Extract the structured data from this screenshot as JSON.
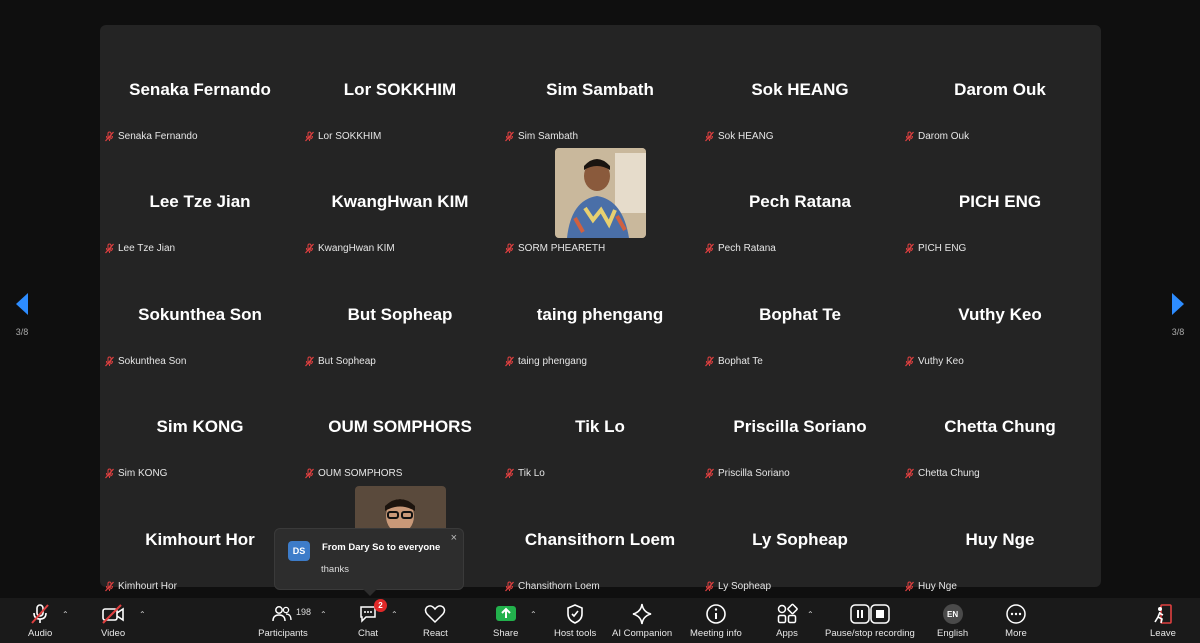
{
  "participants": [
    {
      "name": "Senaka Fernando",
      "label": "Senaka Fernando"
    },
    {
      "name": "Lor SOKKHIM",
      "label": "Lor SOKKHIM"
    },
    {
      "name": "Sim Sambath",
      "label": "Sim Sambath"
    },
    {
      "name": "Sok HEANG",
      "label": "Sok HEANG"
    },
    {
      "name": "Darom Ouk",
      "label": "Darom Ouk"
    },
    {
      "name": "Lee Tze Jian",
      "label": "Lee Tze Jian"
    },
    {
      "name": "KwangHwan KIM",
      "label": "KwangHwan KIM"
    },
    {
      "name": "",
      "label": "SORM PHEARETH"
    },
    {
      "name": "Pech Ratana",
      "label": "Pech Ratana"
    },
    {
      "name": "PICH ENG",
      "label": "PICH ENG"
    },
    {
      "name": "Sokunthea Son",
      "label": "Sokunthea Son"
    },
    {
      "name": "But Sopheap",
      "label": "But Sopheap"
    },
    {
      "name": "taing phengang",
      "label": "taing phengang"
    },
    {
      "name": "Bophat Te",
      "label": "Bophat Te"
    },
    {
      "name": "Vuthy Keo",
      "label": "Vuthy Keo"
    },
    {
      "name": "Sim KONG",
      "label": "Sim KONG"
    },
    {
      "name": "OUM SOMPHORS",
      "label": "OUM SOMPHORS"
    },
    {
      "name": "Tik Lo",
      "label": "Tik Lo"
    },
    {
      "name": "Priscilla Soriano",
      "label": "Priscilla Soriano"
    },
    {
      "name": "Chetta Chung",
      "label": "Chetta Chung"
    },
    {
      "name": "Kimhourt Hor",
      "label": "Kimhourt Hor"
    },
    {
      "name": "",
      "label": ""
    },
    {
      "name": "Chansithorn Loem",
      "label": "Chansithorn Loem"
    },
    {
      "name": "Ly Sopheap",
      "label": "Ly Sopheap"
    },
    {
      "name": "Huy Nge",
      "label": "Huy Nge"
    }
  ],
  "pager": {
    "left": "3/8",
    "right": "3/8"
  },
  "chat_popup": {
    "avatar": "DS",
    "from": "From Dary So to everyone",
    "message": "thanks",
    "close": "×"
  },
  "toolbar": {
    "audio": "Audio",
    "video": "Video",
    "participants": "Participants",
    "participants_count": "198",
    "chat": "Chat",
    "chat_badge": "2",
    "react": "React",
    "share": "Share",
    "host_tools": "Host tools",
    "ai_companion": "AI Companion",
    "meeting_info": "Meeting info",
    "apps": "Apps",
    "recording": "Pause/stop recording",
    "language": "English",
    "language_code": "EN",
    "more": "More",
    "leave": "Leave"
  },
  "colors": {
    "mute_red": "#e04040",
    "share_green": "#22b14c",
    "nav_blue": "#2d8cff",
    "badge_red": "#e02828"
  }
}
